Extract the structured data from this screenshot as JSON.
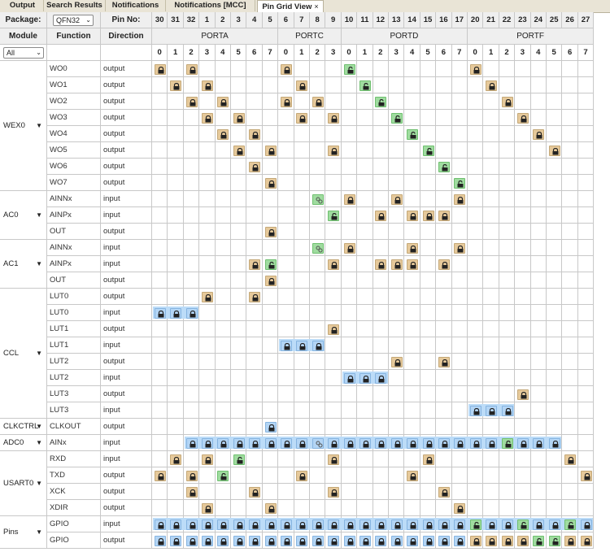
{
  "tabs": [
    {
      "label": "Output"
    },
    {
      "label": "Search Results"
    },
    {
      "label": "Notifications"
    },
    {
      "label": "Notifications [MCC]"
    },
    {
      "label": "Pin Grid View",
      "active": true,
      "close": "×"
    }
  ],
  "header": {
    "package_label": "Package:",
    "package_value": "QFN32",
    "pin_no_label": "Pin No:",
    "module_label": "Module",
    "function_label": "Function",
    "direction_label": "Direction",
    "module_filter": "All"
  },
  "pin_numbers": [
    "30",
    "31",
    "32",
    "1",
    "2",
    "3",
    "4",
    "5",
    "6",
    "7",
    "8",
    "9",
    "10",
    "11",
    "12",
    "13",
    "14",
    "15",
    "16",
    "17",
    "20",
    "21",
    "22",
    "23",
    "24",
    "25",
    "26",
    "27"
  ],
  "ports": [
    {
      "name": "PORTA",
      "start": 0,
      "count": 8
    },
    {
      "name": "PORTC",
      "start": 8,
      "count": 4
    },
    {
      "name": "PORTD",
      "start": 12,
      "count": 8
    },
    {
      "name": "PORTF",
      "start": 20,
      "count": 8
    }
  ],
  "bit_numbers": [
    "0",
    "1",
    "2",
    "3",
    "4",
    "5",
    "6",
    "7",
    "0",
    "1",
    "2",
    "3",
    "0",
    "1",
    "2",
    "3",
    "4",
    "5",
    "6",
    "7",
    "0",
    "1",
    "2",
    "3",
    "4",
    "5",
    "6",
    "7"
  ],
  "modules": [
    {
      "name": "WEX0",
      "arrow": "▼",
      "rows": [
        {
          "fn": "WO0",
          "dir": "output",
          "pins": {
            "0": "u",
            "2": "u",
            "8": "u",
            "12": "g",
            "20": "u"
          }
        },
        {
          "fn": "WO1",
          "dir": "output",
          "pins": {
            "1": "u",
            "3": "u",
            "9": "u",
            "13": "g",
            "21": "u"
          }
        },
        {
          "fn": "WO2",
          "dir": "output",
          "pins": {
            "2": "u",
            "4": "u",
            "8": "u",
            "10": "u",
            "14": "g",
            "22": "u"
          }
        },
        {
          "fn": "WO3",
          "dir": "output",
          "pins": {
            "3": "u",
            "5": "u",
            "9": "u",
            "11": "u",
            "15": "g",
            "23": "u"
          }
        },
        {
          "fn": "WO4",
          "dir": "output",
          "pins": {
            "4": "u",
            "6": "u",
            "16": "g",
            "24": "u"
          }
        },
        {
          "fn": "WO5",
          "dir": "output",
          "pins": {
            "5": "u",
            "7": "u",
            "11": "u",
            "17": "g",
            "25": "u"
          }
        },
        {
          "fn": "WO6",
          "dir": "output",
          "pins": {
            "6": "u",
            "18": "g"
          }
        },
        {
          "fn": "WO7",
          "dir": "output",
          "pins": {
            "7": "u",
            "19": "g"
          }
        }
      ]
    },
    {
      "name": "AC0",
      "arrow": "▼",
      "rows": [
        {
          "fn": "AINNx",
          "dir": "input",
          "pins": {
            "10": "gl",
            "12": "u",
            "15": "u",
            "19": "u"
          }
        },
        {
          "fn": "AINPx",
          "dir": "input",
          "pins": {
            "11": "g",
            "14": "u",
            "16": "u",
            "17": "u",
            "18": "u"
          }
        },
        {
          "fn": "OUT",
          "dir": "output",
          "pins": {
            "7": "u"
          }
        }
      ]
    },
    {
      "name": "AC1",
      "arrow": "▼",
      "rows": [
        {
          "fn": "AINNx",
          "dir": "input",
          "pins": {
            "10": "gl",
            "12": "u",
            "16": "u",
            "19": "u"
          }
        },
        {
          "fn": "AINPx",
          "dir": "input",
          "pins": {
            "6": "u",
            "7": "g",
            "11": "u",
            "14": "u",
            "15": "u",
            "16": "u",
            "18": "u"
          }
        },
        {
          "fn": "OUT",
          "dir": "output",
          "pins": {
            "7": "u"
          }
        }
      ]
    },
    {
      "name": "CCL",
      "arrow": "▼",
      "rows": [
        {
          "fn": "LUT0",
          "dir": "output",
          "pins": {
            "3": "u",
            "6": "u"
          }
        },
        {
          "fn": "LUT0",
          "dir": "input",
          "pins": {
            "0": "b",
            "1": "b",
            "2": "b"
          },
          "bar": [
            0,
            2
          ]
        },
        {
          "fn": "LUT1",
          "dir": "output",
          "pins": {
            "11": "u"
          }
        },
        {
          "fn": "LUT1",
          "dir": "input",
          "pins": {
            "8": "b",
            "9": "b",
            "10": "b"
          },
          "bar": [
            8,
            10
          ]
        },
        {
          "fn": "LUT2",
          "dir": "output",
          "pins": {
            "15": "u",
            "18": "u"
          }
        },
        {
          "fn": "LUT2",
          "dir": "input",
          "pins": {
            "12": "b",
            "13": "b",
            "14": "b"
          },
          "bar": [
            12,
            14
          ]
        },
        {
          "fn": "LUT3",
          "dir": "output",
          "pins": {
            "23": "u"
          }
        },
        {
          "fn": "LUT3",
          "dir": "input",
          "pins": {
            "20": "b",
            "21": "b",
            "22": "b"
          },
          "bar": [
            20,
            22
          ]
        }
      ]
    },
    {
      "name": "CLKCTRL",
      "arrow": "▼",
      "rows": [
        {
          "fn": "CLKOUT",
          "dir": "output",
          "pins": {
            "7": "b"
          }
        }
      ]
    },
    {
      "name": "ADC0",
      "arrow": "▼",
      "rows": [
        {
          "fn": "AINx",
          "dir": "input",
          "pins": {
            "2": "b",
            "3": "b",
            "4": "b",
            "5": "b",
            "6": "b",
            "7": "b",
            "8": "b",
            "9": "b",
            "10": "bl",
            "11": "b",
            "12": "b",
            "13": "b",
            "14": "b",
            "15": "b",
            "16": "b",
            "17": "b",
            "18": "b",
            "19": "b",
            "20": "b",
            "21": "b",
            "22": "g",
            "23": "b",
            "24": "b",
            "25": "b"
          },
          "bar": [
            2,
            25
          ]
        }
      ]
    },
    {
      "name": "USART0",
      "arrow": "▼",
      "rows": [
        {
          "fn": "RXD",
          "dir": "input",
          "pins": {
            "1": "u",
            "3": "u",
            "5": "g",
            "11": "u",
            "17": "u",
            "26": "u"
          }
        },
        {
          "fn": "TXD",
          "dir": "output",
          "pins": {
            "0": "u",
            "2": "u",
            "4": "g",
            "9": "u",
            "16": "u",
            "27": "u"
          }
        },
        {
          "fn": "XCK",
          "dir": "output",
          "pins": {
            "2": "u",
            "6": "u",
            "11": "u",
            "18": "u"
          }
        },
        {
          "fn": "XDIR",
          "dir": "output",
          "pins": {
            "3": "u",
            "7": "u",
            "19": "u"
          }
        }
      ]
    },
    {
      "name": "Pins",
      "arrow": "▼",
      "rows": [
        {
          "fn": "GPIO",
          "dir": "input",
          "all": "b",
          "green": [
            20,
            23,
            26
          ],
          "bar": [
            0,
            27
          ]
        },
        {
          "fn": "GPIO",
          "dir": "output",
          "all": "b",
          "green": [
            24,
            25
          ],
          "tan": [
            20,
            21,
            22,
            23,
            26,
            27
          ]
        }
      ]
    }
  ]
}
